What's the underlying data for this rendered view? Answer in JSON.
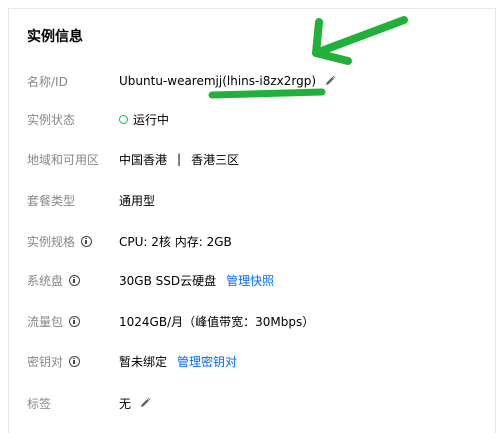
{
  "card": {
    "title": "实例信息"
  },
  "rows": [
    {
      "label": "名称/ID",
      "value": "Ubuntu-wearemjj(lhins-i8zx2rgp)"
    },
    {
      "label": "实例状态",
      "value": "运行中"
    },
    {
      "label": "地域和可用区",
      "region": "中国香港",
      "separator": "|",
      "zone": "香港三区"
    },
    {
      "label": "套餐类型",
      "value": "通用型"
    },
    {
      "label": "实例规格",
      "value": "CPU: 2核 内存: 2GB"
    },
    {
      "label": "系统盘",
      "value": "30GB SSD云硬盘",
      "link": "管理快照"
    },
    {
      "label": "流量包",
      "value": "1024GB/月（峰值带宽：30Mbps）"
    },
    {
      "label": "密钥对",
      "value": "暂未绑定",
      "link": "管理密钥对"
    },
    {
      "label": "标签",
      "value": "无"
    }
  ],
  "icons": {
    "edit": "pencil-icon",
    "info": "info-circle-icon",
    "status": "status-running-icon"
  },
  "colors": {
    "link": "#006eff",
    "status_running": "#0abf5b",
    "annotation": "#22b03a"
  }
}
